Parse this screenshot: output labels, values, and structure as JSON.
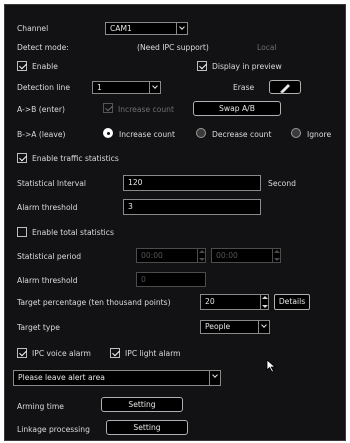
{
  "channel": {
    "label": "Channel",
    "value": "CAM1"
  },
  "detect_mode": {
    "label": "Detect mode:",
    "value": "(Need IPC support)",
    "local": "Local"
  },
  "enable": {
    "label": "Enable",
    "checked": true
  },
  "display_in_preview": {
    "label": "Display in preview",
    "checked": true
  },
  "detection_line": {
    "label": "Detection line",
    "value": "1",
    "erase_label": "Erase",
    "erase_icon": "pencil-eraser-icon"
  },
  "a_to_b": {
    "label": "A->B (enter)",
    "increase_label": "Increase count",
    "swap_label": "Swap A/B"
  },
  "b_to_a": {
    "label": "B->A (leave)",
    "options": [
      "Increase count",
      "Decrease count",
      "Ignore"
    ],
    "selected": "Increase count"
  },
  "traffic": {
    "label": "Enable traffic statistics",
    "checked": true
  },
  "statistical_interval": {
    "label": "Statistical Interval",
    "value": "120",
    "unit": "Second"
  },
  "alarm_threshold_1": {
    "label": "Alarm threshold",
    "value": "3"
  },
  "total": {
    "label": "Enable total statistics",
    "checked": false
  },
  "statistical_period": {
    "label": "Statistical period",
    "start": "00:00",
    "end": "00:00"
  },
  "alarm_threshold_2": {
    "label": "Alarm threshold",
    "value": "0"
  },
  "target_percentage": {
    "label": "Target percentage (ten thousand points)",
    "value": "20",
    "details_label": "Details"
  },
  "target_type": {
    "label": "Target type",
    "value": "People"
  },
  "ipc_voice_alarm": {
    "label": "IPC voice alarm",
    "checked": true
  },
  "ipc_light_alarm": {
    "label": "IPC light alarm",
    "checked": true
  },
  "alert_message": {
    "value": "Please leave alert area"
  },
  "arming_time": {
    "label": "Arming time",
    "button": "Setting"
  },
  "linkage_processing": {
    "label": "Linkage processing",
    "button": "Setting"
  },
  "colors": {
    "panel_bg": "#121214",
    "text": "#dcdcdc",
    "disabled_text": "#6f6f6f",
    "field_bg": "#000000"
  }
}
